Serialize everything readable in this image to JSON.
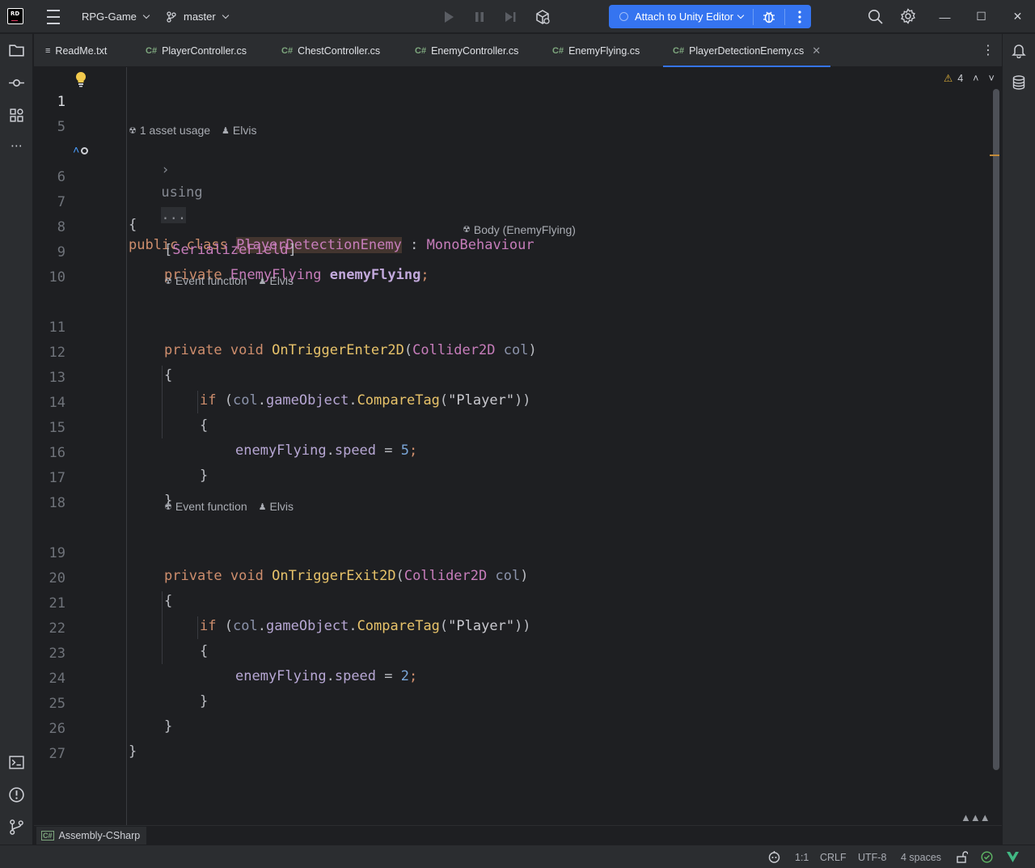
{
  "titlebar": {
    "project": "RPG-Game",
    "branch": "master",
    "attach_label": "Attach to Unity Editor"
  },
  "tabs": [
    {
      "label": "ReadMe.txt",
      "kind": "text",
      "prefix": "≡"
    },
    {
      "label": "PlayerController.cs",
      "kind": "csharp",
      "prefix": "C#"
    },
    {
      "label": "ChestController.cs",
      "kind": "csharp",
      "prefix": "C#"
    },
    {
      "label": "EnemyController.cs",
      "kind": "csharp",
      "prefix": "C#"
    },
    {
      "label": "EnemyFlying.cs",
      "kind": "csharp",
      "prefix": "C#"
    },
    {
      "label": "PlayerDetectionEnemy.cs",
      "kind": "csharp",
      "prefix": "C#",
      "active": true
    }
  ],
  "editor": {
    "warnings_count": "4",
    "line_numbers": [
      "1",
      "5",
      "6",
      "7",
      "8",
      "9",
      "10",
      "11",
      "12",
      "13",
      "14",
      "15",
      "16",
      "17",
      "18",
      "19",
      "20",
      "21",
      "22",
      "23",
      "24",
      "25",
      "26",
      "27"
    ],
    "folded_using": "using",
    "folded_ellipsis": "...",
    "inlays": {
      "class_usage": "1 asset usage",
      "author": "Elvis",
      "field_hint": "Body (EnemyFlying)",
      "event_function": "Event function"
    },
    "tokens": {
      "public": "public",
      "class": "class",
      "class_name": "PlayerDetectionEnemy",
      "colon": ":",
      "base": "MonoBehaviour",
      "open_brace": "{",
      "close_brace": "}",
      "attr_open": "[",
      "attr_name": "SerializeField",
      "attr_close": "]",
      "private": "private",
      "field_type": "EnemyFlying",
      "field_name": "enemyFlying",
      "semicolon": ";",
      "void": "void",
      "enter_fn": "OnTriggerEnter2D",
      "exit_fn": "OnTriggerExit2D",
      "lparen": "(",
      "rparen": ")",
      "param_type": "Collider2D",
      "param_name": "col",
      "if": "if",
      "dot": ".",
      "gameObject": "gameObject",
      "compare": "CompareTag",
      "player_str": "\"Player\"",
      "close_parens": "))",
      "speed": "speed",
      "eq": "=",
      "speed_enter": "5",
      "speed_exit": "2"
    }
  },
  "breadcrumb": {
    "label": "Assembly-CSharp",
    "prefix": "C#"
  },
  "status": {
    "position": "1:1",
    "line_ending": "CRLF",
    "encoding": "UTF-8",
    "indent": "4 spaces"
  }
}
